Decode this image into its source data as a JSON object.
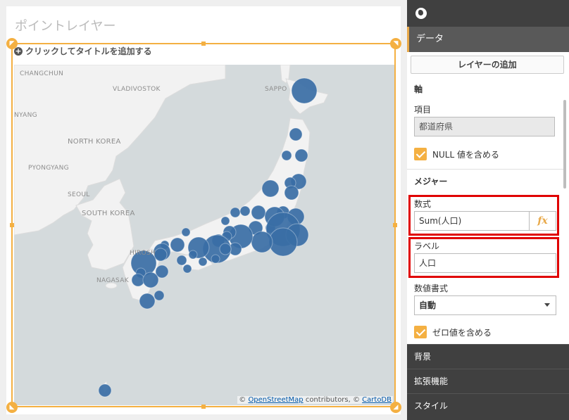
{
  "object": {
    "title": "ポイントレイヤー",
    "subtitle": "クリックしてタイトルを追加する"
  },
  "map": {
    "labels": {
      "changchun": "CHANGCHUN",
      "vladivostok": "VLADIVOSTOK",
      "sapporo": "SAPPO",
      "nyang": "NYANG",
      "north_korea": "NORTH KOREA",
      "pyongyang": "PYONGYANG",
      "seoul": "SEOUL",
      "south_korea": "SOUTH KOREA",
      "hiroshima": "HIROSH",
      "nagasaki": "NAGASAK"
    },
    "attribution": {
      "prefix": "© ",
      "osm_link": "OpenStreetMap",
      "middle": " contributors, © ",
      "carto_link": "CartoDB"
    },
    "colors": {
      "water": "#d4dadc",
      "land": "#f2f2f2",
      "bubble": "#3a6ea5",
      "selection": "#f4b042"
    }
  },
  "panel": {
    "tab_data": "データ",
    "add_layer_button": "レイヤーの追加",
    "axis_heading": "軸",
    "item_label": "項目",
    "item_value": "都道府県",
    "include_null_label": "NULL 値を含める",
    "measure_heading": "メジャー",
    "expression_label": "数式",
    "expression_value": "Sum(人口)",
    "fx_label": "fx",
    "label_label": "ラベル",
    "label_value": "人口",
    "number_format_label": "数値書式",
    "number_format_value": "自動",
    "include_zero_label": "ゼロ値を含める",
    "section_background": "背景",
    "section_extensions": "拡張機能",
    "section_style": "スタイル"
  }
}
